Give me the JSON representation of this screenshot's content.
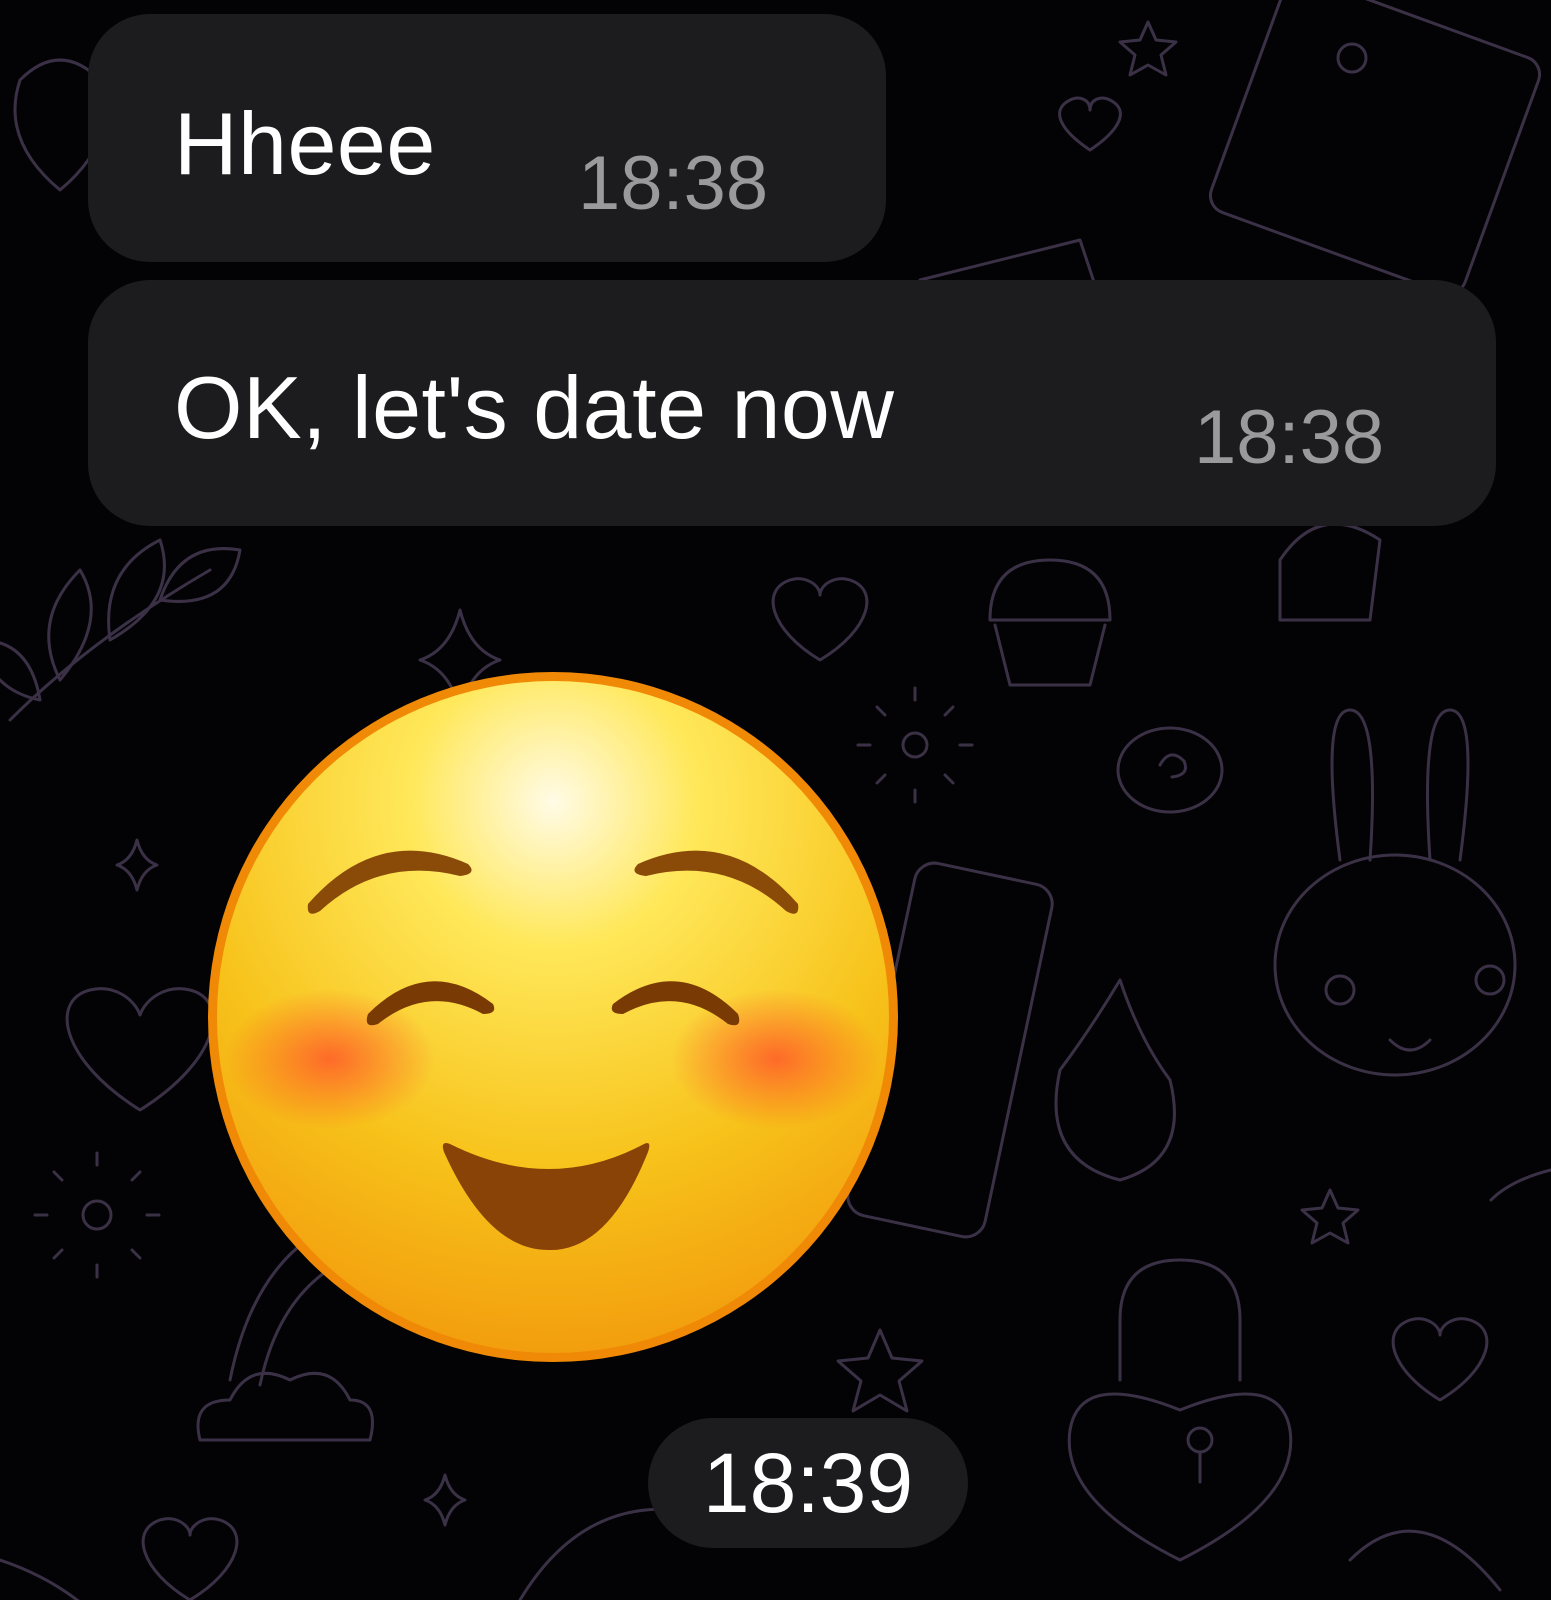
{
  "messages": [
    {
      "text": "Hheee",
      "time": "18:38"
    },
    {
      "text": "OK, let's date now",
      "time": "18:38"
    }
  ],
  "sticker": {
    "emoji": "smiling-face-with-blush",
    "time": "18:39"
  },
  "colors": {
    "background": "#030205",
    "pattern": "#3b3146",
    "bubble": "#1c1c1e",
    "text": "#ffffff",
    "timestamp": "#9a9a9c",
    "emoji_face": "#f5c518"
  }
}
